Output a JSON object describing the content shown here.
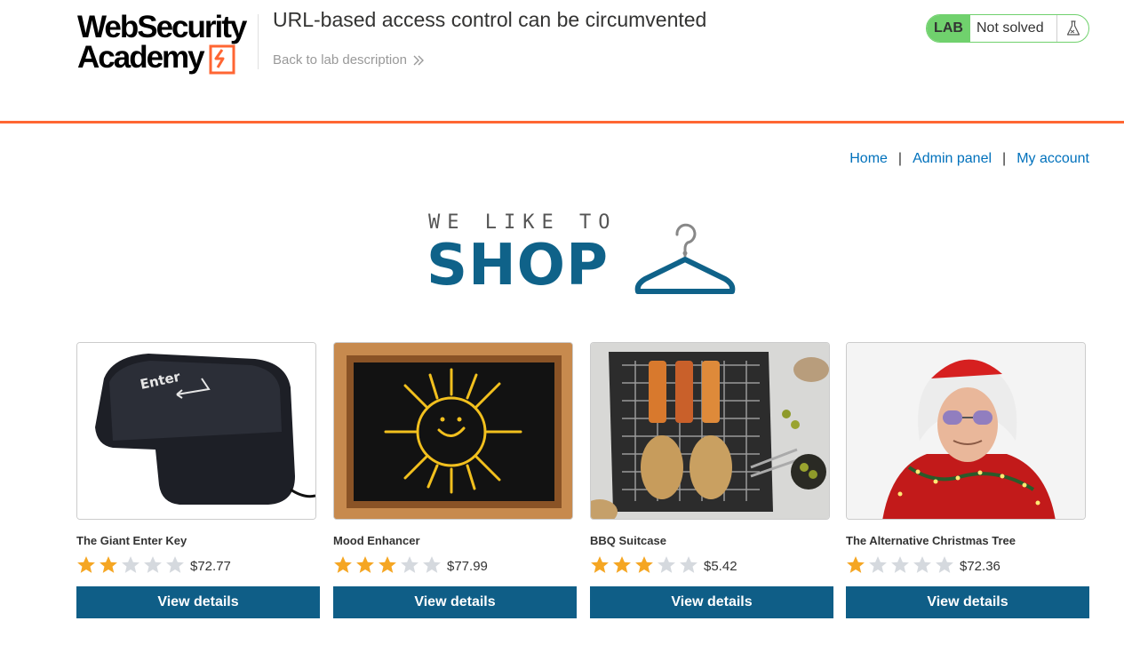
{
  "academy": {
    "logo_line1": "WebSecurity",
    "logo_line2": "Academy",
    "lab_title": "URL-based access control can be circumvented",
    "back_link": "Back to lab description",
    "status": {
      "badge": "LAB",
      "text": "Not solved",
      "icon": "flask-icon"
    }
  },
  "nav": {
    "home": "Home",
    "admin": "Admin panel",
    "account": "My account",
    "separator": "|"
  },
  "banner": {
    "small": "WE LIKE TO",
    "big": "SHOP"
  },
  "products": [
    {
      "name": "The Giant Enter Key",
      "rating": 2,
      "max_rating": 5,
      "price": "$72.77",
      "button": "View details"
    },
    {
      "name": "Mood Enhancer",
      "rating": 3,
      "max_rating": 5,
      "price": "$77.99",
      "button": "View details"
    },
    {
      "name": "BBQ Suitcase",
      "rating": 3,
      "max_rating": 5,
      "price": "$5.42",
      "button": "View details"
    },
    {
      "name": "The Alternative Christmas Tree",
      "rating": 1,
      "max_rating": 5,
      "price": "$72.36",
      "button": "View details"
    }
  ],
  "colors": {
    "accent_orange": "#ff6633",
    "button_blue": "#0f5e87",
    "link_blue": "#0071bc",
    "lab_green": "#70d16d",
    "star_filled": "#f5a623",
    "star_empty": "#d5d9de"
  }
}
